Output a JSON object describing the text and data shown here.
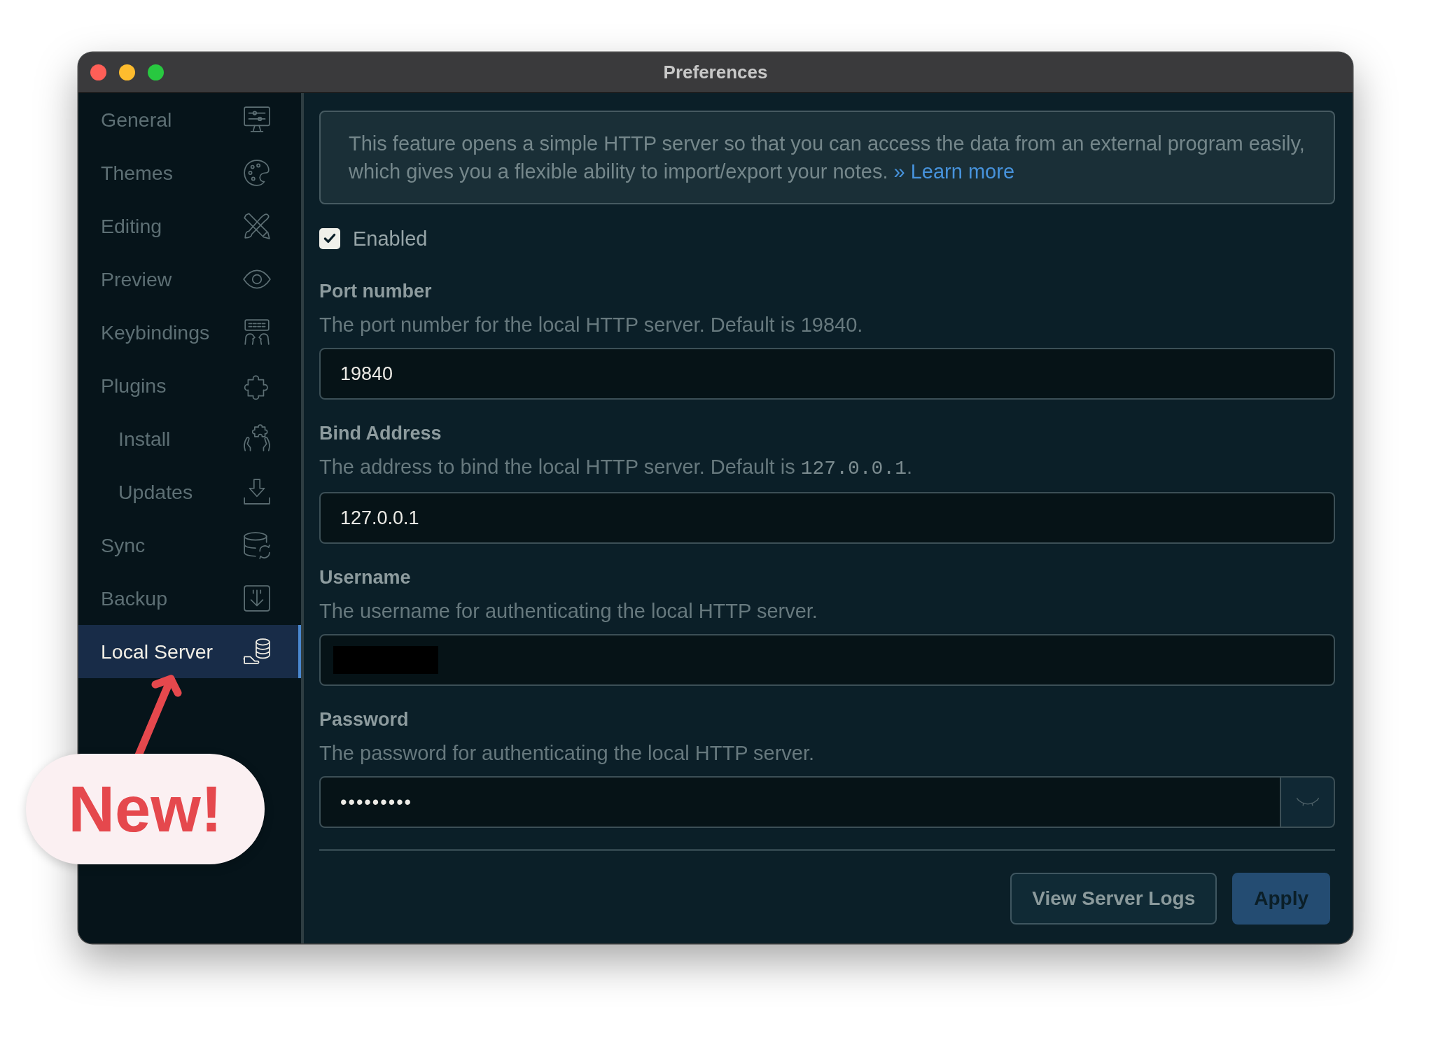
{
  "window": {
    "title": "Preferences"
  },
  "sidebar": {
    "items": [
      {
        "label": "General",
        "selected": false
      },
      {
        "label": "Themes",
        "selected": false
      },
      {
        "label": "Editing",
        "selected": false
      },
      {
        "label": "Preview",
        "selected": false
      },
      {
        "label": "Keybindings",
        "selected": false
      },
      {
        "label": "Plugins",
        "selected": false,
        "children": [
          {
            "label": "Install",
            "selected": false
          },
          {
            "label": "Updates",
            "selected": false
          }
        ]
      },
      {
        "label": "Sync",
        "selected": false
      },
      {
        "label": "Backup",
        "selected": false
      },
      {
        "label": "Local Server",
        "selected": true
      }
    ]
  },
  "info": {
    "text": "This feature opens a simple HTTP server so that you can access the data from an external program easily, which gives you a flexible ability to import/export your notes.",
    "link": "» Learn more"
  },
  "enabled": {
    "label": "Enabled",
    "checked": true
  },
  "fields": [
    {
      "kind": "text",
      "label": "Port number",
      "description": [
        {
          "kind": "plain",
          "text": "The port number for the local HTTP server. Default is 19840."
        }
      ],
      "value": "19840"
    },
    {
      "kind": "text",
      "label": "Bind Address",
      "description": [
        {
          "kind": "plain",
          "text": "The address to bind the local HTTP server. Default is "
        },
        {
          "kind": "code",
          "text": "127.0.0.1"
        },
        {
          "kind": "plain",
          "text": "."
        }
      ],
      "value": "127.0.0.1"
    },
    {
      "kind": "text",
      "label": "Username",
      "description": [
        {
          "kind": "plain",
          "text": "The username for authenticating the local HTTP server."
        }
      ],
      "redacted": true
    },
    {
      "kind": "password",
      "label": "Password",
      "description": [
        {
          "kind": "plain",
          "text": "The password for authenticating the local HTTP server."
        }
      ],
      "value": "•••••••••"
    }
  ],
  "buttons": [
    {
      "label": "View Server Logs",
      "kind": "secondary"
    },
    {
      "label": "Apply",
      "kind": "primary"
    }
  ],
  "annotation": {
    "text": "New!"
  }
}
